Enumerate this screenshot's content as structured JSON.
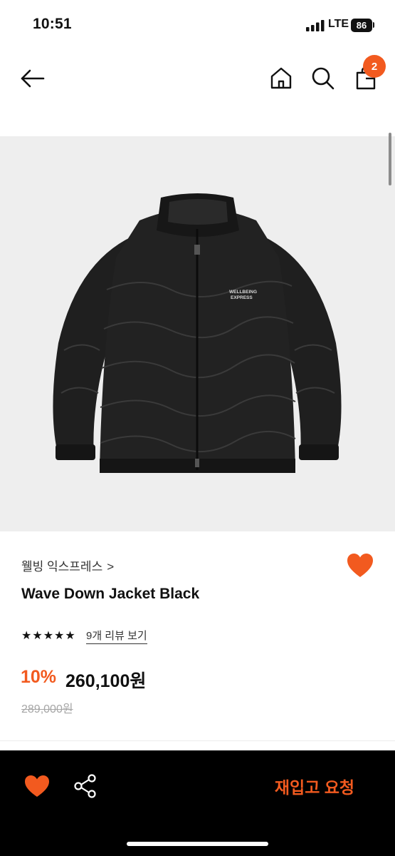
{
  "status_bar": {
    "time": "10:51",
    "network": "LTE",
    "battery": "86",
    "signal_icon": "signal-bars-icon"
  },
  "nav": {
    "back_icon": "arrow-left-icon",
    "home_icon": "home-icon",
    "search_icon": "search-icon",
    "cart_icon": "shopping-bag-icon",
    "cart_badge": "2"
  },
  "product": {
    "image_description": "black-down-jacket",
    "jacket_logo_line1": "WELLBEING",
    "jacket_logo_line2": "EXPRESS",
    "brand": "웰빙 익스프레스",
    "brand_chevron": ">",
    "title": "Wave Down Jacket Black",
    "stars": "★★★★★",
    "rating": 5,
    "review_link": "9개 리뷰 보기",
    "discount": "10%",
    "sale_price": "260,100원",
    "original_price": "289,000원",
    "wish_icon": "heart-icon"
  },
  "bottom_bar": {
    "heart_icon": "heart-icon",
    "share_icon": "share-icon",
    "restock_label": "재입고 요청"
  },
  "colors": {
    "accent": "#f25a1f",
    "text": "#111111",
    "muted": "#a6a6a6",
    "image_bg": "#eeeeee",
    "bottom_bar_bg": "#000000"
  }
}
